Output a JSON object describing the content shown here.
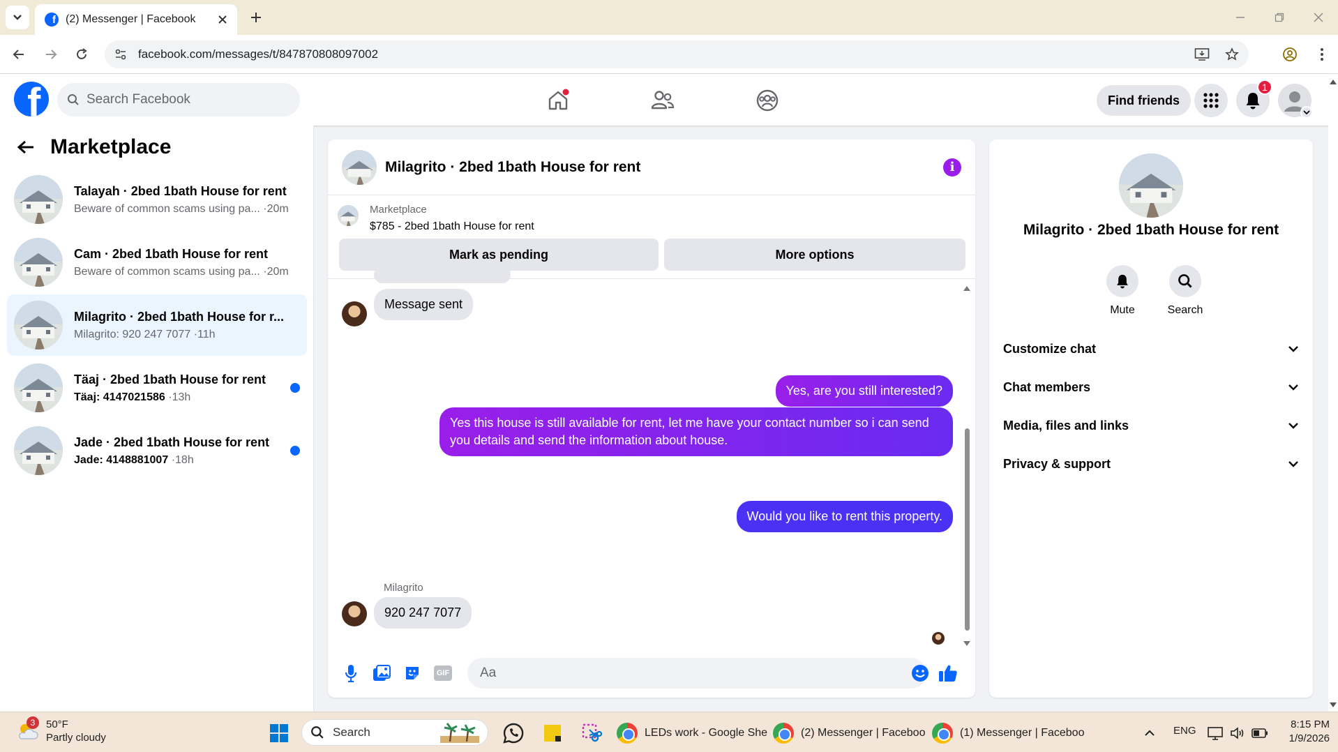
{
  "browser": {
    "tab_title": "(2) Messenger | Facebook",
    "url": "facebook.com/messages/t/847870808097002"
  },
  "fb_header": {
    "search_placeholder": "Search Facebook",
    "find_friends": "Find friends",
    "notification_count": "1"
  },
  "left": {
    "title": "Marketplace",
    "conversations": [
      {
        "name": "Talayah · 2bed 1bath House for rent",
        "snippet": "Beware of common scams using pa...",
        "time": "·20m",
        "unread": false,
        "active": false
      },
      {
        "name": "Cam · 2bed 1bath House for rent",
        "snippet": "Beware of common scams using pa...",
        "time": "·20m",
        "unread": false,
        "active": false
      },
      {
        "name": "Milagrito · 2bed 1bath House for r...",
        "snippet": "Milagrito: 920 247 7077",
        "time": "·11h",
        "unread": false,
        "active": true
      },
      {
        "name": "Täaj · 2bed 1bath House for rent",
        "snippet": "Täaj: 4147021586",
        "time": "·13h",
        "unread": true,
        "active": false
      },
      {
        "name": "Jade · 2bed 1bath House for rent",
        "snippet": "Jade: 4148881007",
        "time": "·18h",
        "unread": true,
        "active": false
      }
    ]
  },
  "chat": {
    "title": "Milagrito · 2bed 1bath House for rent",
    "marketplace_label": "Marketplace",
    "listing": "$785 - 2bed 1bath House for rent",
    "mark_pending": "Mark as pending",
    "more_options": "More options",
    "messages": {
      "m1": "Message sent",
      "m2": "Yes, are you still interested?",
      "m3": "Yes this house is still available for rent, let me have your contact number so i can send you details and send the information about house.",
      "m4": "Would you like to rent this property.",
      "sender": "Milagrito",
      "m5": "920 247 7077"
    },
    "composer_placeholder": "Aa",
    "gif_label": "GIF"
  },
  "right": {
    "name": "Milagrito · 2bed 1bath House for rent",
    "mute": "Mute",
    "search": "Search",
    "sections": [
      "Customize chat",
      "Chat members",
      "Media, files and links",
      "Privacy & support"
    ]
  },
  "taskbar": {
    "temp": "50°F",
    "weather": "Partly cloudy",
    "weather_badge": "3",
    "search": "Search",
    "apps": [
      "LEDs work - Google She",
      "(2) Messenger | Faceboo",
      "(1) Messenger | Faceboo"
    ],
    "lang": "ENG",
    "time": "8:15 PM",
    "date": "1/9/2026"
  },
  "colors": {
    "fb_blue": "#0866ff",
    "accent_purple": "#9a1eea",
    "bubble_blue": "#4b31f4"
  }
}
